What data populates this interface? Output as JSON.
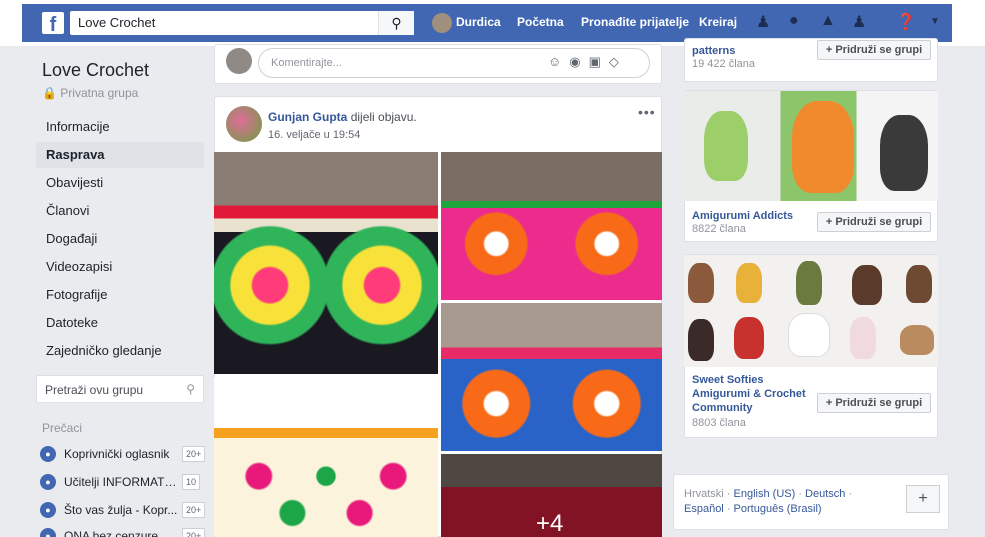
{
  "topbar": {
    "logo": "f",
    "search_value": "Love Crochet",
    "search_icon": "search-icon",
    "user_name": "Durdica",
    "links": [
      "Početna",
      "Pronađite prijatelje",
      "Kreiraj"
    ],
    "icons": [
      "friends-icon",
      "messenger-icon",
      "notifications-icon",
      "groups-icon",
      "help-icon",
      "chevron-down-icon"
    ],
    "brand_color": "#4267b2"
  },
  "sidebar": {
    "group_name": "Love Crochet",
    "group_type": "Privatna grupa",
    "items": [
      "Informacije",
      "Rasprava",
      "Obavijesti",
      "Članovi",
      "Događaji",
      "Videozapisi",
      "Fotografije",
      "Datoteke",
      "Zajedničko gledanje"
    ],
    "active_item": "Rasprava",
    "search_placeholder": "Pretraži ovu grupu",
    "shortcuts_heading": "Prečaci",
    "shortcuts": [
      {
        "label": "Koprivnički oglasnik",
        "badge": "20+"
      },
      {
        "label": "Učitelji INFORMATIKE",
        "badge": "10"
      },
      {
        "label": "Što vas žulja - Kopr...",
        "badge": "20+"
      },
      {
        "label": "ONA bez cenzure",
        "badge": "20+"
      }
    ]
  },
  "composer": {
    "placeholder": "Komentirajte..."
  },
  "post": {
    "author": "Gunjan Gupta",
    "action": "dijeli objavu.",
    "time": "16. veljače u 19:54",
    "more_photos": "+4"
  },
  "suggestions": [
    {
      "name": "patterns",
      "members": "19 422 člana",
      "button": "+ Pridruži se grupi"
    },
    {
      "name": "Amigurumi Addicts",
      "members": "8822 člana",
      "button": "+ Pridruži se grupi"
    },
    {
      "name": "Sweet Softies Amigurumi & Crochet Community",
      "members": "8803 člana",
      "button": "+ Pridruži se grupi"
    }
  ],
  "languages": {
    "current": "Hrvatski",
    "others_row1": [
      "English (US)",
      "Deutsch"
    ],
    "others_row2": [
      "Español",
      "Português (Brasil)"
    ],
    "add_label": "+"
  }
}
